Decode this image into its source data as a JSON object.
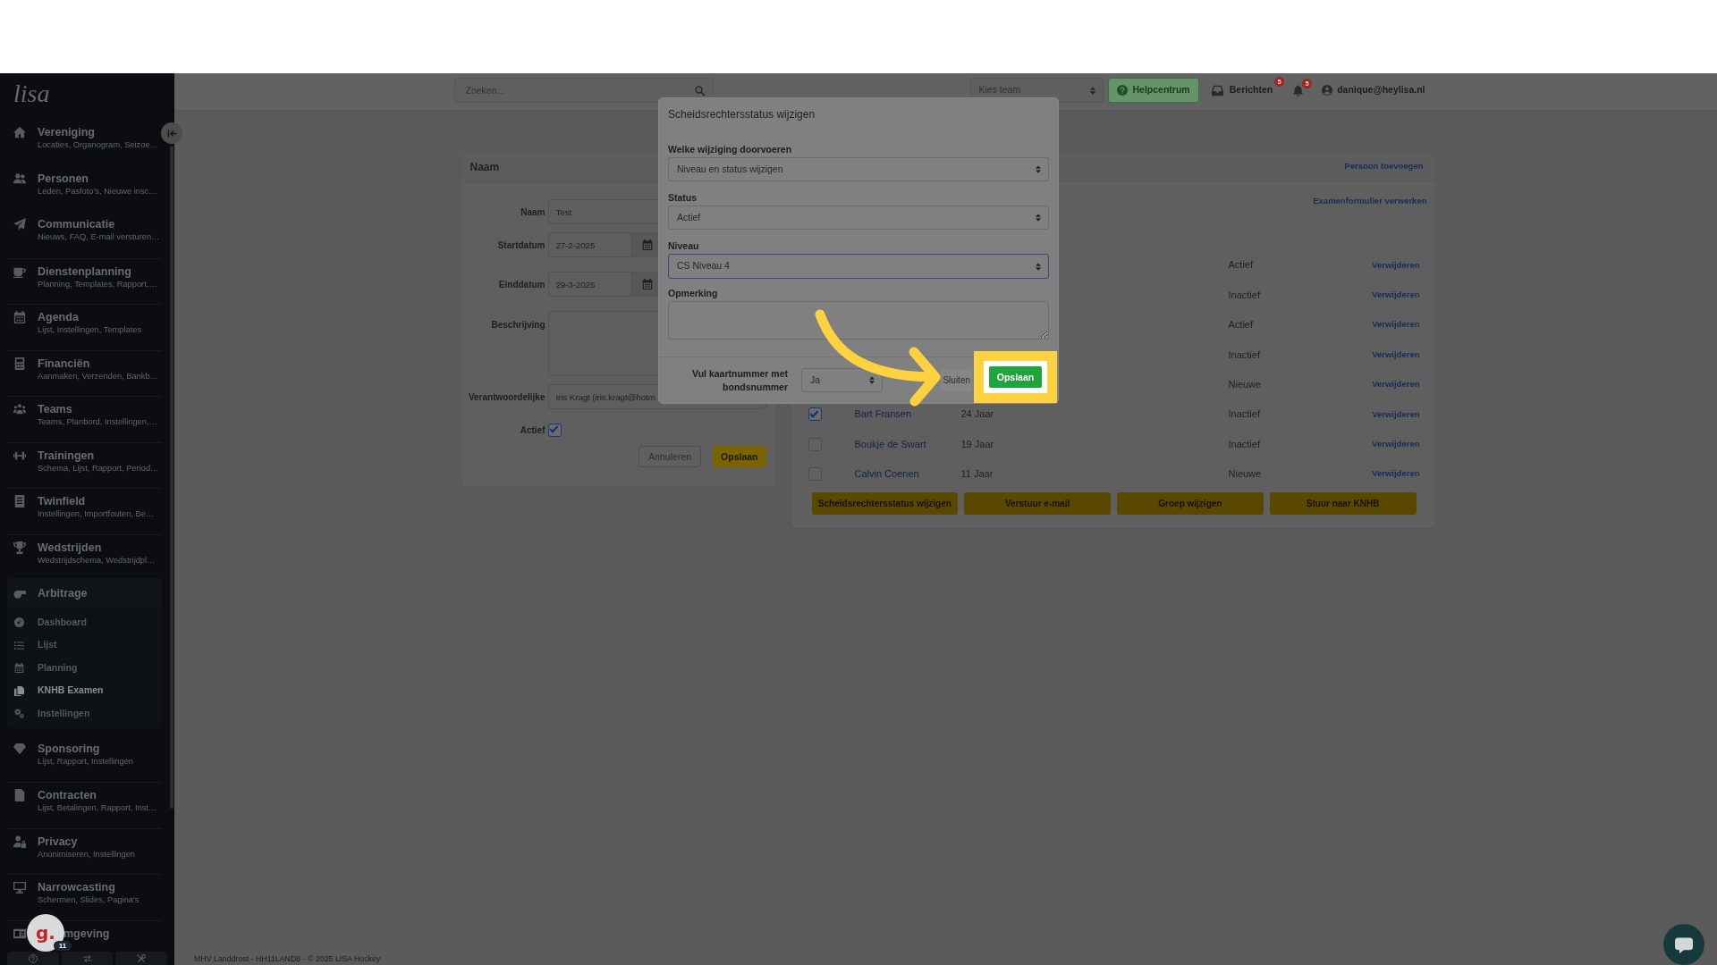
{
  "sidebar": {
    "logo": "lisa",
    "items": [
      {
        "kind": "link",
        "title": "Vereniging",
        "subtitle": "Locaties, Organogram, Seizoe…"
      },
      {
        "kind": "link",
        "title": "Personen",
        "subtitle": "Leden, Pasfoto's, Nieuwe insc…"
      },
      {
        "kind": "link",
        "title": "Communicatie",
        "subtitle": "Nieuws, FAQ, E-mail versturen…"
      },
      {
        "kind": "link",
        "title": "Dienstenplanning",
        "subtitle": "Planning, Templates, Rapport,…"
      },
      {
        "kind": "link",
        "title": "Agenda",
        "subtitle": "Lijst, Instellingen, Templates"
      },
      {
        "kind": "link",
        "title": "Financiën",
        "subtitle": "Aanmaken, Verzenden, Bankb…"
      },
      {
        "kind": "link",
        "title": "Teams",
        "subtitle": "Teams, Planbord, Instellingen,…"
      },
      {
        "kind": "link",
        "title": "Trainingen",
        "subtitle": "Schema, Lijst, Rapport, Period…"
      },
      {
        "kind": "link",
        "title": "Twinfield",
        "subtitle": "Instellingen, Importfouten, Be…"
      },
      {
        "kind": "link",
        "title": "Wedstrijden",
        "subtitle": "Wedstrijdschema, Wedstrijdpl…"
      },
      {
        "kind": "group",
        "title": "Arbitrage",
        "expanded": true,
        "children": [
          {
            "label": "Dashboard",
            "selected": false
          },
          {
            "label": "Lijst",
            "selected": false
          },
          {
            "label": "Planning",
            "selected": false
          },
          {
            "label": "KNHB Examen",
            "selected": true
          },
          {
            "label": "Instellingen",
            "selected": false
          }
        ]
      },
      {
        "kind": "link",
        "title": "Sponsoring",
        "subtitle": "Lijst, Rapport, Instellingen"
      },
      {
        "kind": "link",
        "title": "Contracten",
        "subtitle": "Lijst, Betalingen, Rapport, Inst…"
      },
      {
        "kind": "link",
        "title": "Privacy",
        "subtitle": "Anonimiseren, Instellingen"
      },
      {
        "kind": "link",
        "title": "Narrowcasting",
        "subtitle": "Schermen, Slides, Pagina's"
      },
      {
        "kind": "link",
        "title": "mgeving"
      }
    ]
  },
  "top_bar": {
    "search": {
      "placeholder": "Zoeken..."
    },
    "team_select": {
      "placeholder": "Kies team"
    },
    "help_button": "Helpcentrum",
    "messages": {
      "label": "Berichten",
      "badge": "5"
    },
    "notifications": {
      "badge": "5"
    },
    "user": "danique@heylisa.nl"
  },
  "form_card": {
    "title": "Naam",
    "fields": [
      {
        "kind": "text",
        "label": "Naam",
        "value": "Test"
      },
      {
        "kind": "date",
        "label": "Startdatum",
        "value": "27-2-2025"
      },
      {
        "kind": "date",
        "label": "Einddatum",
        "value": "29-3-2025"
      },
      {
        "kind": "textarea",
        "label": "Beschrijving"
      },
      {
        "kind": "text",
        "label": "Verantwoordelijke",
        "value": "Iris Kragt (iris.kragt@hotm"
      },
      {
        "kind": "checkbox",
        "label": "Actief",
        "checked": true
      }
    ],
    "buttons": [
      {
        "kind": "secondary",
        "label": "Annuleren"
      },
      {
        "kind": "primary",
        "label": "Opslaan"
      }
    ]
  },
  "persons_card": {
    "add_link": "Persoon toevoegen",
    "exam_link": "Examenformulier verwerken",
    "rows": [
      {
        "status": "Actief",
        "action": "Verwijderen"
      },
      {
        "status": "Inactief",
        "action": "Verwijderen"
      },
      {
        "status": "Actief",
        "action": "Verwijderen"
      },
      {
        "status": "Inactief",
        "action": "Verwijderen"
      },
      {
        "status": "Nieuwe",
        "action": "Verwijderen"
      },
      {
        "checked": true,
        "name": "Bart Fransen",
        "age": "24 Jaar",
        "status": "Inactief",
        "action": "Verwijderen"
      },
      {
        "checked": false,
        "name": "Boukje de Swart",
        "age": "19 Jaar",
        "status": "Inactief",
        "action": "Verwijderen"
      },
      {
        "checked": false,
        "name": "Calvin Coenen",
        "age": "11 Jaar",
        "status": "Nieuwe",
        "action": "Verwijderen"
      }
    ],
    "buttons": [
      "Scheidsrechtersstatus wijzigen",
      "Verstuur e-mail",
      "Groep wijzigen",
      "Stuur naar KNHB"
    ]
  },
  "dialog": {
    "title": "Scheidsrechtersstatus wijzigen",
    "fields": [
      {
        "kind": "select",
        "label": "Welke wijziging doorvoeren",
        "value": "Niveau en status wijzigen",
        "focused": false
      },
      {
        "kind": "select",
        "label": "Status",
        "value": "Actief",
        "focused": false
      },
      {
        "kind": "select",
        "label": "Niveau",
        "value": "CS Niveau 4",
        "focused": true
      },
      {
        "kind": "textarea",
        "label": "Opmerking",
        "focused": false
      }
    ],
    "footer": {
      "label": "Vul kaartnummer met bondsnummer",
      "select": "Ja",
      "buttons": [
        {
          "kind": "secondary",
          "label": "Sluiten",
          "highlighted": false
        },
        {
          "kind": "primary",
          "label": "Opslaan",
          "highlighted": true
        }
      ]
    }
  },
  "footer": "MHV Landdrost - HH11LAND8 - © 2025 LISA Hockey",
  "support_widget": {
    "logo": "g.",
    "badge": "11"
  }
}
